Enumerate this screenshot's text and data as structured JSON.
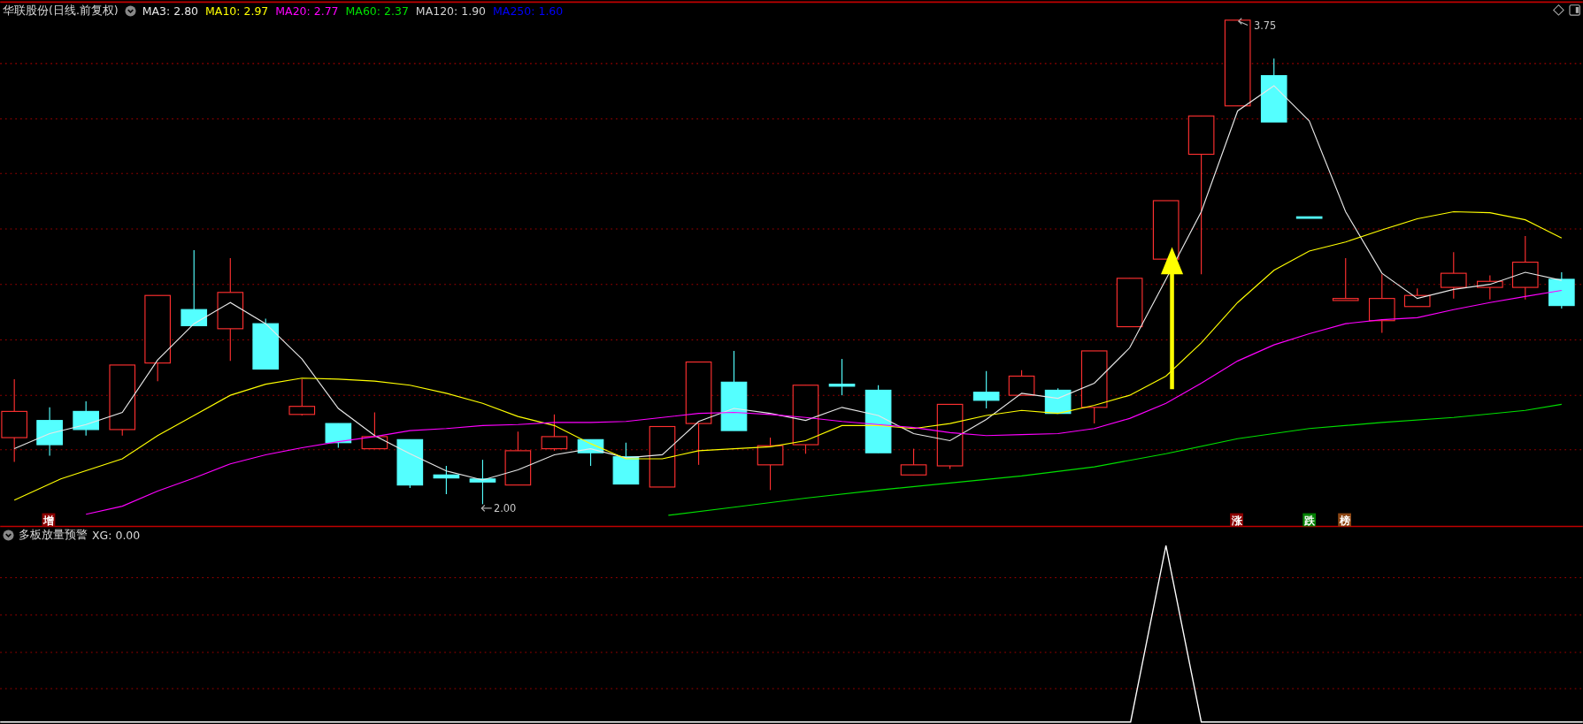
{
  "main_pane": {
    "title": "华联股份(日线.前复权)",
    "indicators": [
      {
        "label": "MA3: 2.80",
        "color": "#e8e8e8"
      },
      {
        "label": "MA10: 2.97",
        "color": "#ffff00"
      },
      {
        "label": "MA20: 2.77",
        "color": "#ff00ff"
      },
      {
        "label": "MA60: 2.37",
        "color": "#00e000"
      },
      {
        "label": "MA120: 1.90",
        "color": "#d0d0d0"
      },
      {
        "label": "MA250: 1.60",
        "color": "#0000ff"
      }
    ],
    "high_label": "3.75",
    "low_label": "2.00",
    "signals": [
      {
        "text": "增",
        "color": "#8b0000"
      },
      {
        "text": "涨",
        "color": "#8b0000"
      },
      {
        "text": "跌",
        "color": "#008000"
      },
      {
        "text": "榜",
        "color": "#8b4513"
      }
    ]
  },
  "lower_pane": {
    "title": "多板放量预警",
    "reading": "XG: 0.00"
  }
}
